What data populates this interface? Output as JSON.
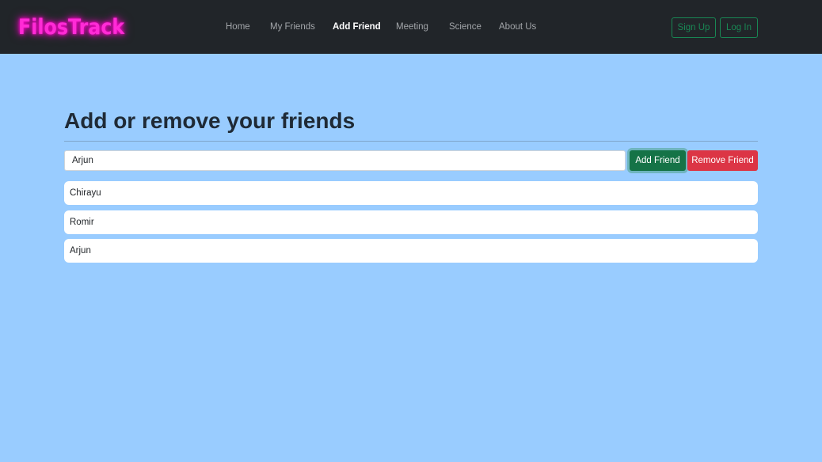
{
  "brand": "FilosTrack",
  "nav": {
    "links": [
      "Home",
      "My Friends",
      "Add Friend",
      "Meeting",
      "Science",
      "About Us"
    ],
    "active": "Add Friend",
    "sign_up": "Sign Up",
    "log_in": "Log In"
  },
  "main": {
    "title": "Add or remove your friends",
    "input_value": "Arjun",
    "add_button": "Add Friend",
    "remove_button": "Remove Friend",
    "friends": [
      "Chirayu",
      "Romir",
      "Arjun"
    ]
  },
  "colors": {
    "background": "#99ccff",
    "navbar": "#212529",
    "brand_neon": "#ff2bd6",
    "success": "#198754",
    "danger": "#dc3545"
  }
}
